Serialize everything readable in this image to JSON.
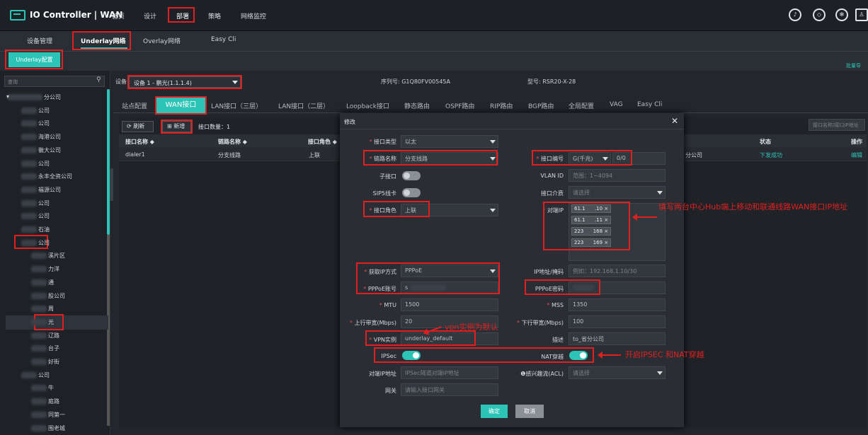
{
  "app": {
    "title": "IO Controller | WAN"
  },
  "topnav": [
    "首页",
    "设计",
    "部署",
    "策略",
    "网络监控"
  ],
  "subtabs": [
    "设备管理",
    "Underlay网络",
    "Overlay网络",
    "Easy Cli"
  ],
  "underlay_button": "Underlay配置",
  "batch_label": "批量导",
  "left": {
    "search_placeholder": "查询",
    "tree": [
      "分公司",
      "公司",
      "公司",
      "海港公司",
      "徽大公司",
      "公司",
      "永丰全资公司",
      "福源公司",
      "公司",
      "公司",
      "石油",
      "公司",
      "溪片区",
      "力洋",
      "通",
      "股公司",
      "周",
      "光",
      "辽路",
      "台子",
      "好街",
      "公司",
      "牛",
      "庭路",
      "同第一",
      "围老城"
    ]
  },
  "device": {
    "label": "设备",
    "selected": "设备 1 - 鹏光(1.1.1.4)",
    "serial_label": "序列号: G1Q80FV00545A",
    "model_label": "型号: RSR20-X-28"
  },
  "config_tabs": [
    "站点配置",
    "WAN接口",
    "LAN接口（三层）",
    "LAN接口（二层）",
    "Loopback接口",
    "静态路由",
    "OSPF路由",
    "RIP路由",
    "BGP路由",
    "全局配置",
    "VAG",
    "Easy Cli"
  ],
  "toolbar": {
    "refresh": "刷新",
    "add": "新增",
    "count": "接口数量：1",
    "search_placeholder": "接口名称/接口IP地址"
  },
  "table": {
    "headers": [
      "接口名称 ◆",
      "链路名称 ◆",
      "接口角色 ◆",
      "状态",
      "操作"
    ],
    "row": {
      "name": "dialer1",
      "link": "分支线路",
      "role": "上联",
      "branch": "分公司",
      "status": "下发成功",
      "action": "编辑"
    }
  },
  "modal": {
    "title": "修改",
    "fields": {
      "if_type_label": "接口类型",
      "if_type_value": "以太",
      "link_name_label": "链路名称",
      "link_name_value": "分支线路",
      "sub_if_label": "子接口",
      "sip5_label": "SIP5线卡",
      "role_label": "接口角色",
      "role_value": "上联",
      "if_no_label": "接口编号",
      "if_no_speed": "G(千兆)",
      "if_no_value": "0/0",
      "vlan_label": "VLAN ID",
      "vlan_placeholder": "范围：1~4094",
      "medium_label": "接口介质",
      "medium_placeholder": "请选择",
      "peer_ip_label": "对端IP",
      "peer_ips": [
        "61.1      .10",
        "61.1      .11",
        "223      168",
        "223      169"
      ],
      "ip_method_label": "获取IP方式",
      "ip_method_value": "PPPoE",
      "ipmask_label": "IP地址/掩码",
      "ipmask_placeholder": "例如：192.168.1.10/30",
      "pppoe_user_label": "PPPoE账号",
      "pppoe_user_value": "s",
      "pppoe_pass_label": "PPPoE密码",
      "mtu_label": "MTU",
      "mtu_value": "1500",
      "mss_label": "MSS",
      "mss_value": "1350",
      "up_bw_label": "上行带宽(Mbps)",
      "up_bw_value": "20",
      "down_bw_label": "下行带宽(Mbps)",
      "down_bw_value": "100",
      "vpn_label": "VPN实例",
      "vpn_value": "underlay_default",
      "desc_label": "描述",
      "desc_value": "to_省分公司",
      "ipsec_label": "IPSec",
      "nat_label": "NAT穿越",
      "peer_ipaddr_label": "对端IP地址",
      "peer_ipaddr_placeholder": "IPSec隧道对端IP地址",
      "acl_label": "❶感兴趣流(ACL)",
      "acl_placeholder": "请选择",
      "gw_label": "网关",
      "gw_placeholder": "请输入接口网关"
    },
    "ok": "确定",
    "cancel": "取消"
  },
  "annotations": {
    "peer_ip": "填写两台中心Hub端上移动和联通线路WAN接口IP地址",
    "vpn": "vpn实例为默认",
    "ipsec": "开启IPSEC 和NAT穿越"
  },
  "colors": {
    "accent": "#2bc4b6",
    "highlight": "#e02020"
  }
}
